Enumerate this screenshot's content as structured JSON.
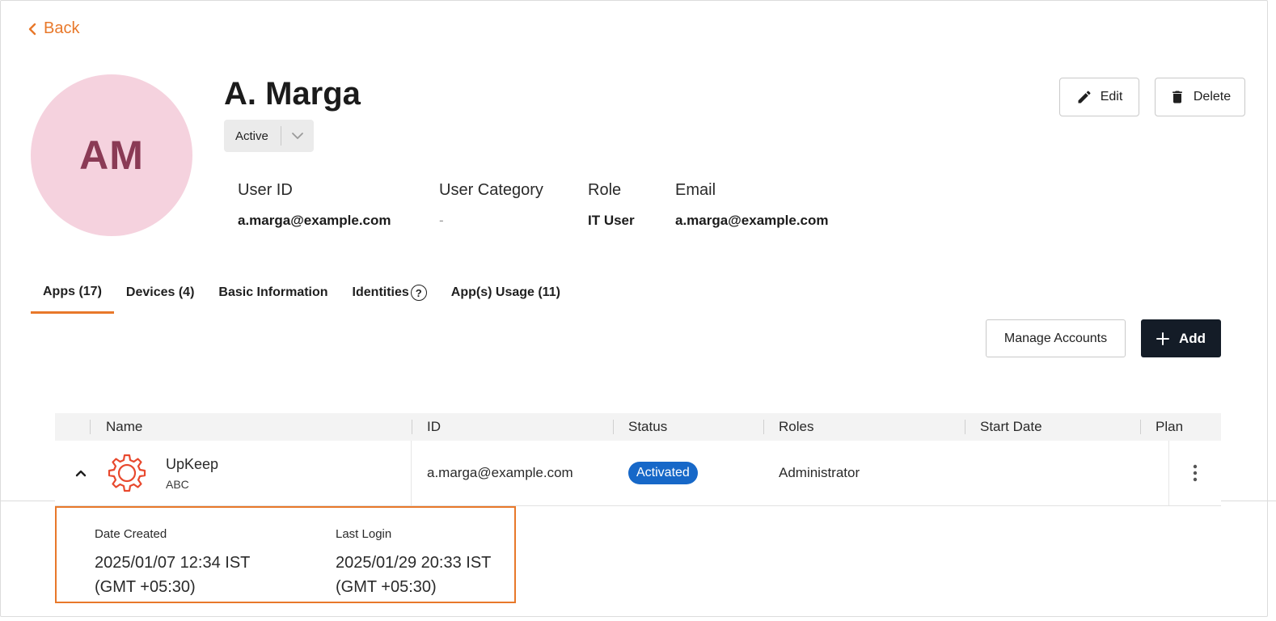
{
  "nav": {
    "back_label": "Back"
  },
  "profile": {
    "initials": "AM",
    "name": "A. Marga",
    "status": "Active"
  },
  "actions": {
    "edit_label": "Edit",
    "delete_label": "Delete"
  },
  "info": [
    {
      "label": "User ID",
      "value": "a.marga@example.com"
    },
    {
      "label": "User Category",
      "value": "-"
    },
    {
      "label": "Role",
      "value": "IT User"
    },
    {
      "label": "Email",
      "value": "a.marga@example.com"
    }
  ],
  "tabs": [
    {
      "label": "Apps (17)",
      "active": true
    },
    {
      "label": "Devices (4)"
    },
    {
      "label": "Basic Information"
    },
    {
      "label": "Identities",
      "help_icon": "?"
    },
    {
      "label": "App(s) Usage (11)"
    }
  ],
  "toolbar": {
    "manage_label": "Manage Accounts",
    "add_label": "Add"
  },
  "table": {
    "columns": [
      "Name",
      "ID",
      "Status",
      "Roles",
      "Start Date",
      "Plan"
    ],
    "rows": [
      {
        "icon": "gear-icon",
        "app_name": "UpKeep",
        "app_sub": "ABC",
        "id": "a.marga@example.com",
        "status": "Activated",
        "roles": "Administrator",
        "start_date": "",
        "plan": ""
      }
    ]
  },
  "details": {
    "date_created_label": "Date Created",
    "date_created_line1": "2025/01/07 12:34 IST",
    "date_created_line2": "(GMT +05:30)",
    "last_login_label": "Last Login",
    "last_login_line1": "2025/01/29 20:33 IST",
    "last_login_line2": "(GMT +05:30)"
  },
  "colors": {
    "accent": "#e8782a",
    "avatar_bg": "#f5d2de",
    "avatar_text": "#8a3a55",
    "badge": "#1768c8",
    "primary_button": "#141c27",
    "app_icon": "#e8492e"
  }
}
